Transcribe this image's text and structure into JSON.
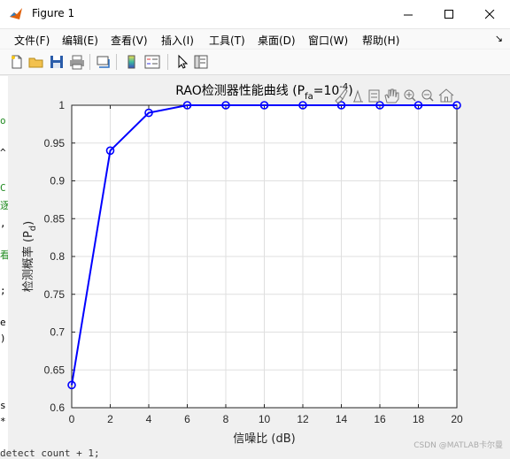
{
  "window": {
    "title": "Figure 1"
  },
  "menu": [
    "文件(F)",
    "编辑(E)",
    "查看(V)",
    "插入(I)",
    "工具(T)",
    "桌面(D)",
    "窗口(W)",
    "帮助(H)"
  ],
  "toolbar_icons": [
    "new-figure-icon",
    "open-file-icon",
    "save-icon",
    "print-icon",
    "link-plot-icon",
    "colorbar-icon",
    "legend-icon",
    "pointer-icon",
    "property-inspector-icon"
  ],
  "axes_toolbar_icons": [
    "brush-icon",
    "data-tips-icon",
    "restore-view-icon",
    "pan-icon",
    "zoom-in-icon",
    "zoom-out-icon",
    "home-icon"
  ],
  "watermark": "CSDN @MATLAB卡尔曼",
  "left_code": [
    "o",
    "^",
    "C",
    "逐",
    ",",
    "看",
    ";",
    "e",
    ")",
    "s",
    "*"
  ],
  "bottom_code": "detect count + 1;",
  "chart_data": {
    "type": "line",
    "title_main": "RAO检测器性能曲线 (P",
    "title_sub": "fa",
    "title_rest": "=10",
    "title_sup": "-4",
    "title_close": ")",
    "xlabel": "信噪比 (dB)",
    "ylabel_main": "检测概率 (P",
    "ylabel_sub": "d",
    "ylabel_close": ")",
    "xlim": [
      0,
      20
    ],
    "ylim": [
      0.6,
      1.0
    ],
    "xticks": [
      0,
      2,
      4,
      6,
      8,
      10,
      12,
      14,
      16,
      18,
      20
    ],
    "yticks": [
      "0.6",
      "0.65",
      "0.7",
      "0.75",
      "0.8",
      "0.85",
      "0.9",
      "0.95",
      "1"
    ],
    "grid": true,
    "color": "#0000ff",
    "marker": "circle",
    "x": [
      0,
      2,
      4,
      6,
      8,
      10,
      12,
      14,
      16,
      18,
      20
    ],
    "y": [
      0.63,
      0.94,
      0.99,
      1.0,
      1.0,
      1.0,
      1.0,
      1.0,
      1.0,
      1.0,
      1.0
    ]
  }
}
